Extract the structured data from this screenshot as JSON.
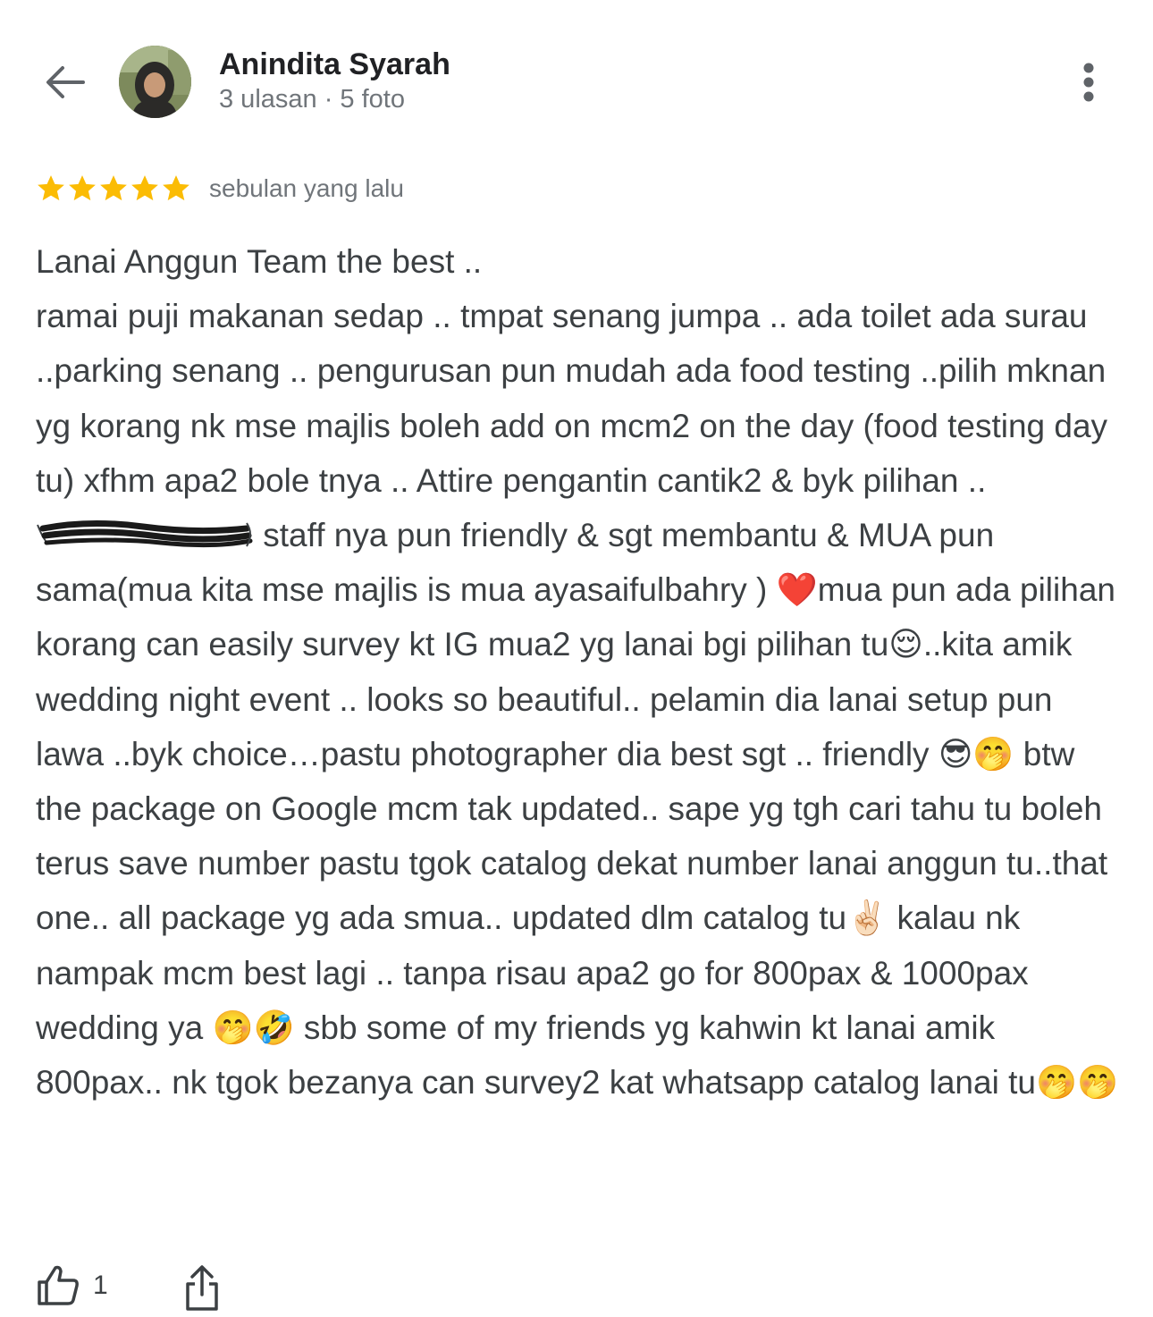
{
  "header": {
    "back_icon": "arrow-back-icon",
    "author_name": "Anindita Syarah",
    "author_meta": "3 ulasan · 5 foto",
    "more_icon": "more-vert-icon"
  },
  "review": {
    "rating": 5,
    "max_rating": 5,
    "star_color": "#fbbc04",
    "time": "sebulan yang lalu",
    "text_before_redaction": "Lanai Anggun Team the best ..\nramai puji makanan sedap .. tmpat senang jumpa .. ada toilet ada surau ..parking senang .. pengurusan pun mudah ada food testing ..pilih mknan yg korang nk mse majlis boleh add on mcm2 on the day (food testing day tu) xfhm apa2 bole tnya .. Attire pengantin cantik2 & byk pilihan .. ",
    "text_after_redaction": " staff nya pun friendly & sgt membantu & MUA pun sama(mua kita mse majlis is mua ayasaifulbahry ) ❤️mua pun ada pilihan korang can easily survey kt IG mua2 yg lanai bgi pilihan tu😌..kita amik wedding night event .. looks so beautiful.. pelamin dia lanai setup pun lawa ..byk choice…pastu photographer dia best sgt .. friendly 😎🤭 btw the package on Google mcm tak updated.. sape yg tgh cari tahu tu boleh terus save number pastu tgok catalog dekat number lanai anggun tu..that one.. all package yg ada smua.. updated dlm catalog tu✌🏻 kalau nk nampak mcm best lagi .. tanpa risau apa2 go for 800pax & 1000pax wedding ya 🤭🤣 sbb some of my friends yg kahwin kt lanai amik 800pax.. nk tgok bezanya can survey2 kat whatsapp catalog lanai tu🤭🤭"
  },
  "actions": {
    "like_icon": "thumb-up-icon",
    "like_count": "1",
    "share_icon": "share-icon"
  },
  "colors": {
    "text_primary": "#202124",
    "text_body": "#3c4043",
    "text_secondary": "#70757a",
    "star": "#fbbc04"
  }
}
